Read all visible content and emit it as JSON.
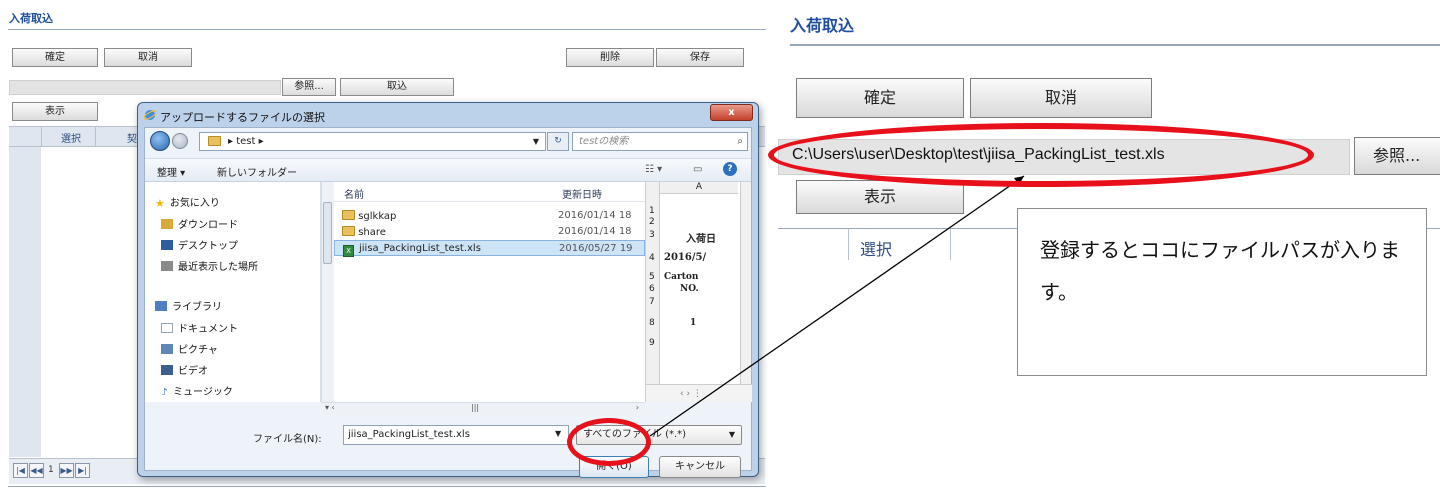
{
  "left_page": {
    "title": "入荷取込",
    "confirm_label": "確定",
    "cancel_label": "取消",
    "delete_label": "削除",
    "save_label": "保存",
    "browse_label": "参照...",
    "import_label": "取込",
    "show_label": "表示",
    "grid_headers": [
      "選択",
      "契"
    ],
    "pager_page": "1"
  },
  "dialog": {
    "title": "アップロードするファイルの選択",
    "close_label": "x",
    "path_crumb": "test",
    "search_placeholder": "testの検索",
    "organize_label": "整理 ▾",
    "new_folder_label": "新しいフォルダー",
    "nav_items": [
      {
        "label": "お気に入り",
        "icon": "star-icon",
        "color": "#f2b705"
      },
      {
        "label": "ダウンロード",
        "icon": "download-folder-icon",
        "color": "#d9a93b"
      },
      {
        "label": "デスクトップ",
        "icon": "desktop-icon",
        "color": "#2f5c9b"
      },
      {
        "label": "最近表示した場所",
        "icon": "recent-places-icon",
        "color": "#8a8a8a"
      },
      {
        "label": "ライブラリ",
        "icon": "library-icon",
        "color": "#4f7ec2"
      },
      {
        "label": "ドキュメント",
        "icon": "document-icon",
        "color": "#9aa6b4"
      },
      {
        "label": "ピクチャ",
        "icon": "picture-icon",
        "color": "#5f86b5"
      },
      {
        "label": "ビデオ",
        "icon": "video-icon",
        "color": "#3a5f8e"
      },
      {
        "label": "ミュージック",
        "icon": "music-icon",
        "color": "#3a6fb0"
      }
    ],
    "list_header_name": "名前",
    "list_header_date": "更新日時",
    "files": [
      {
        "name": "sglkkap",
        "date": "2016/01/14 18",
        "type": "folder",
        "selected": false
      },
      {
        "name": "share",
        "date": "2016/01/14 18",
        "type": "folder",
        "selected": false
      },
      {
        "name": "jiisa_PackingList_test.xls",
        "date": "2016/05/27 19",
        "type": "xls",
        "selected": true
      }
    ],
    "preview": {
      "column": "A",
      "row_numbers": [
        "1",
        "2",
        "3",
        "4",
        "5",
        "6",
        "7",
        "8",
        "9"
      ],
      "cells": [
        "入荷日",
        "2016/5/",
        "Carton",
        "NO.",
        "1"
      ]
    },
    "filename_label": "ファイル名(N):",
    "filename_value": "jiisa_PackingList_test.xls",
    "filetype_value": "すべてのファイル (*.*)",
    "open_label": "開く(O)",
    "cancel_label": "キャンセル"
  },
  "zoom_view": {
    "title": "入荷取込",
    "confirm_label": "確定",
    "cancel_label": "取消",
    "file_path": "C:\\Users\\user\\Desktop\\test\\jiisa_PackingList_test.xls",
    "browse_label": "参照...",
    "show_label": "表示",
    "select_header": "選択"
  },
  "callout": {
    "text": "登録するとココにファイルパスが入ります。"
  },
  "colors": {
    "highlight": "#e8101a",
    "title_blue": "#1f4e9c",
    "dialog_frame": "#bcd1ea",
    "selected_row": "#cde4f7"
  }
}
